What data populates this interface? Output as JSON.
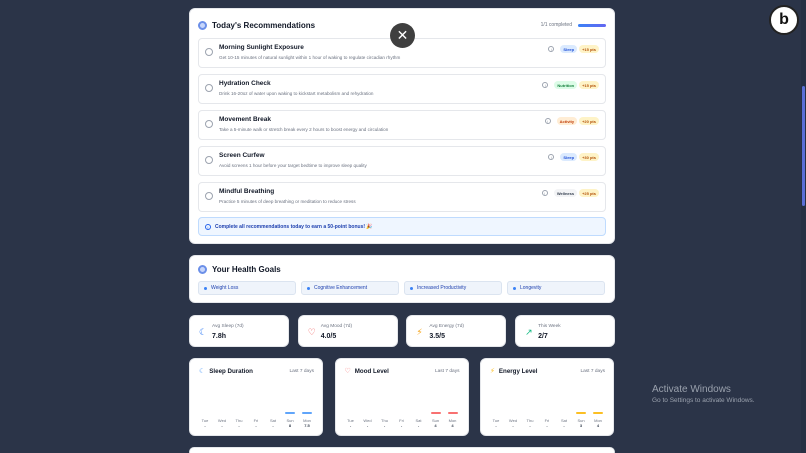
{
  "recommendations": {
    "title": "Today's Recommendations",
    "completed_text": "1/1 completed",
    "progress": 1.0,
    "items": [
      {
        "title": "Morning Sunlight Exposure",
        "desc": "Get 10-15 minutes of natural sunlight within 1 hour of waking to regulate circadian rhythm",
        "category": "Sleep",
        "points": "+15 pts",
        "cat_bg": "#dbeafe",
        "cat_fg": "#1d4ed8"
      },
      {
        "title": "Hydration Check",
        "desc": "Drink 16-20oz of water upon waking to kickstart metabolism and rehydration",
        "category": "Nutrition",
        "points": "+15 pts",
        "cat_bg": "#dcfce7",
        "cat_fg": "#15803d"
      },
      {
        "title": "Movement Break",
        "desc": "Take a 5-minute walk or stretch break every 2 hours to boost energy and circulation",
        "category": "Activity",
        "points": "+20 pts",
        "cat_bg": "#ffedd5",
        "cat_fg": "#c2410c"
      },
      {
        "title": "Screen Curfew",
        "desc": "Avoid screens 1 hour before your target bedtime to improve sleep quality",
        "category": "Sleep",
        "points": "+30 pts",
        "cat_bg": "#dbeafe",
        "cat_fg": "#1d4ed8"
      },
      {
        "title": "Mindful Breathing",
        "desc": "Practice 5 minutes of deep breathing or meditation to reduce stress",
        "category": "Wellness",
        "points": "+25 pts",
        "cat_bg": "#f3f4f6",
        "cat_fg": "#374151"
      }
    ],
    "bonus_text": "Complete all recommendations today to earn a 50-point bonus! 🎉"
  },
  "goals": {
    "title": "Your Health Goals",
    "items": [
      "Weight Loss",
      "Cognitive Enhancement",
      "Increased Productivity",
      "Longevity"
    ]
  },
  "stats": [
    {
      "label": "Avg Sleep (7d)",
      "value": "7.8h",
      "icon": "moon-icon",
      "color": "#3b82f6"
    },
    {
      "label": "Avg Mood (7d)",
      "value": "4.0/5",
      "icon": "heart-icon",
      "color": "#ef4444"
    },
    {
      "label": "Avg Energy (7d)",
      "value": "3.5/5",
      "icon": "bolt-icon",
      "color": "#f59e0b"
    },
    {
      "label": "This Week",
      "value": "2/7",
      "icon": "trend-up-icon",
      "color": "#10b981"
    }
  ],
  "charts": [
    {
      "title": "Sleep Duration",
      "period": "Last 7 days",
      "icon": "moon-icon",
      "color": "#60a5fa",
      "days": [
        "Tue",
        "Wed",
        "Thu",
        "Fri",
        "Sat",
        "Sun",
        "Mon"
      ],
      "values": [
        "-",
        "-",
        "-",
        "-",
        "-",
        "8",
        "7.5"
      ]
    },
    {
      "title": "Mood Level",
      "period": "Last 7 days",
      "icon": "heart-icon",
      "color": "#f87171",
      "days": [
        "Tue",
        "Wed",
        "Thu",
        "Fri",
        "Sat",
        "Sun",
        "Mon"
      ],
      "values": [
        "-",
        "-",
        "-",
        "-",
        "-",
        "4",
        "4"
      ]
    },
    {
      "title": "Energy Level",
      "period": "Last 7 days",
      "icon": "bolt-icon",
      "color": "#fbbf24",
      "days": [
        "Tue",
        "Wed",
        "Thu",
        "Fri",
        "Sat",
        "Sun",
        "Mon"
      ],
      "values": [
        "-",
        "-",
        "-",
        "-",
        "-",
        "3",
        "4"
      ]
    }
  ],
  "close_glyph": "✕",
  "watermark": {
    "title": "Activate Windows",
    "subtitle": "Go to Settings to activate Windows."
  },
  "logo_letter": "b"
}
